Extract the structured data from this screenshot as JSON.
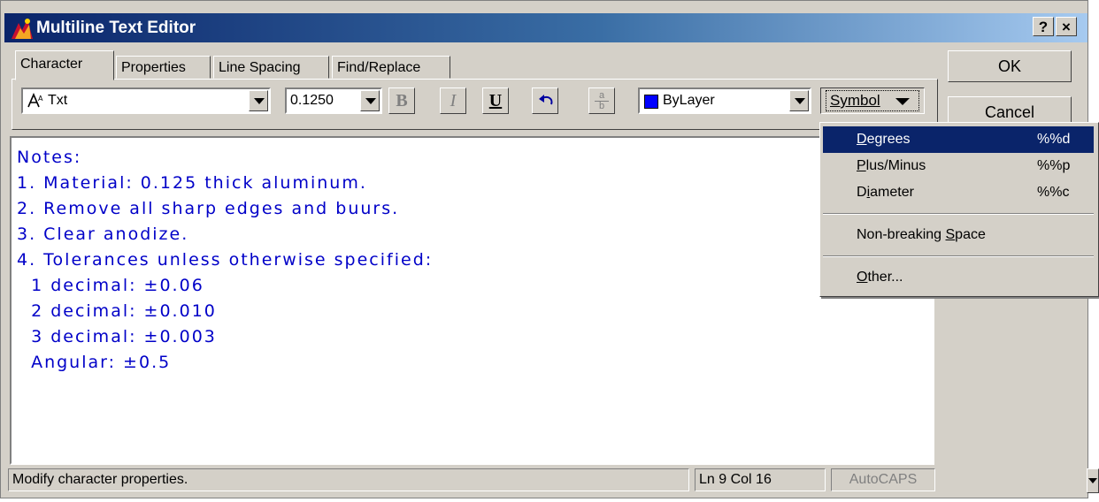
{
  "window": {
    "title": "Multiline Text Editor",
    "help_button": "?",
    "close_button": "×"
  },
  "tabs": [
    {
      "label": "Character"
    },
    {
      "label": "Properties"
    },
    {
      "label": "Line Spacing"
    },
    {
      "label": "Find/Replace"
    }
  ],
  "toolbar": {
    "font_value": "Txt",
    "height_value": "0.1250",
    "bold_label": "B",
    "italic_label": "I",
    "underline_label": "U",
    "stack_top": "a",
    "stack_bottom": "b",
    "color_value": "ByLayer",
    "color_swatch": "#0000ff",
    "symbol_label": "Symbol"
  },
  "buttons": {
    "ok": "OK",
    "cancel": "Cancel"
  },
  "editor": {
    "text_color": "#0000c8",
    "lines": [
      "Notes:",
      "1. Material: 0.125 thick aluminum.",
      "2. Remove all sharp edges and buurs.",
      "3. Clear anodize.",
      "4. Tolerances unless otherwise specified:",
      "  1 decimal: ±0.06",
      "  2 decimal: ±0.010",
      "  3 decimal: ±0.003",
      "  Angular: ±0.5"
    ]
  },
  "status": {
    "message": "Modify character properties.",
    "position": "Ln 9 Col 16",
    "autocaps": "AutoCAPS"
  },
  "symbol_menu": {
    "items": [
      {
        "label": "Degrees",
        "mnemonic": "D",
        "rest": "egrees",
        "shortcut": "%%d",
        "highlighted": true
      },
      {
        "label": "Plus/Minus",
        "mnemonic": "P",
        "rest": "lus/Minus",
        "shortcut": "%%p"
      },
      {
        "label": "Diameter",
        "pre": "D",
        "mnemonic": "i",
        "rest": "ameter",
        "shortcut": "%%c"
      }
    ],
    "nbsp": {
      "label": "Non-breaking Space",
      "pre": "Non-breaking ",
      "mnemonic": "S",
      "rest": "pace"
    },
    "other": {
      "label": "Other...",
      "mnemonic": "O",
      "rest": "ther..."
    }
  },
  "colors": {
    "titlebar_start": "#0a246a",
    "titlebar_end": "#a6caf0",
    "highlight": "#0a246a",
    "face": "#d4d0c8"
  }
}
